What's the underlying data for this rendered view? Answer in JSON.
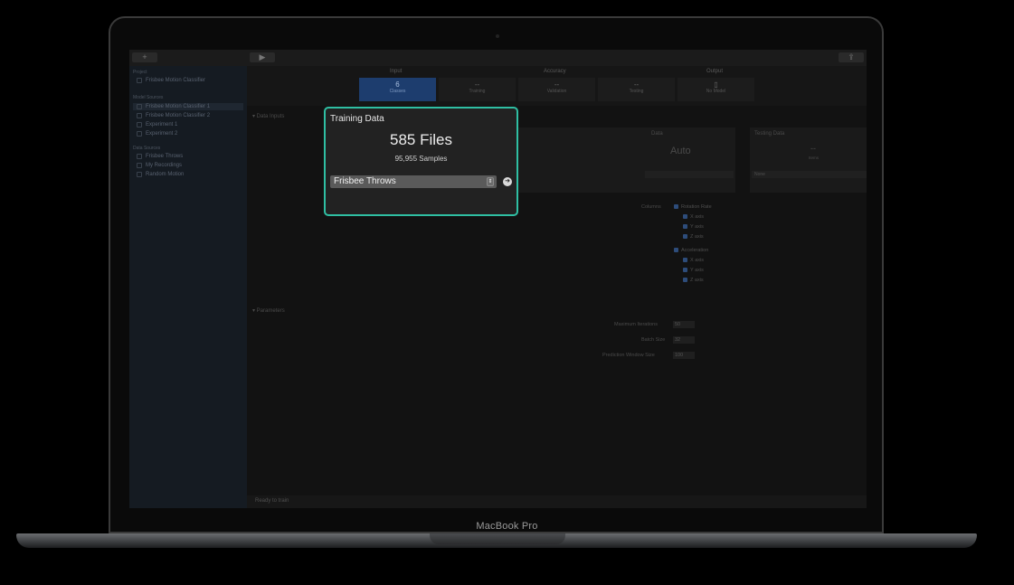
{
  "device_label": "MacBook Pro",
  "toolbar": {
    "add_label": "+",
    "run_icon": "play-icon",
    "share_icon": "share-icon"
  },
  "sidebar": {
    "project_header": "Project",
    "project_item": "Frisbee Motion Classifier",
    "model_header": "Model Sources",
    "model_items": [
      "Frisbee Motion Classifier 1",
      "Frisbee Motion Classifier 2",
      "Experiment 1",
      "Experiment 2"
    ],
    "data_header": "Data Sources",
    "data_items": [
      "Frisbee Throws",
      "My Recordings",
      "Random Motion"
    ]
  },
  "stages": {
    "input": "Input",
    "accuracy": "Accuracy",
    "output": "Output",
    "classes_value": "6",
    "classes_label": "Classes",
    "training_value": "--",
    "training_label": "Training",
    "validation_value": "--",
    "validation_label": "Validation",
    "testing_value": "--",
    "testing_label": "Testing",
    "model_label": "No Model"
  },
  "sections": {
    "data_inputs": "▾ Data Inputs",
    "parameters": "▾ Parameters"
  },
  "validation_panel": {
    "title": "Data",
    "value": "Auto"
  },
  "testing_panel": {
    "title": "Testing Data",
    "value": "--",
    "sub": "Items",
    "select": "None"
  },
  "features": {
    "label": "Columns",
    "rotation": "Rotation Rate",
    "rotation_axes": [
      "X axis",
      "Y axis",
      "Z axis"
    ],
    "acceleration": "Acceleration",
    "acceleration_axes": [
      "X axis",
      "Y axis",
      "Z axis"
    ]
  },
  "parameters": {
    "max_iterations_label": "Maximum Iterations",
    "max_iterations": "50",
    "batch_size_label": "Batch Size",
    "batch_size": "32",
    "window_label": "Prediction Window Size",
    "window": "100"
  },
  "status": "Ready to train",
  "training_card": {
    "title": "Training Data",
    "files": "585 Files",
    "samples": "95,955 Samples",
    "source": "Frisbee Throws",
    "accent_color": "#2fbfa3"
  }
}
